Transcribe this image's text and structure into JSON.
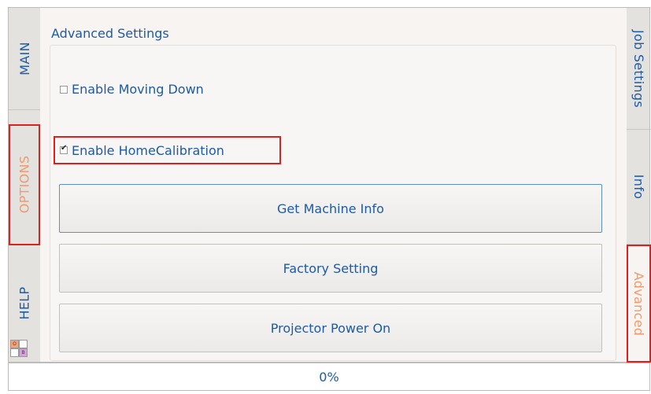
{
  "left_tabs": [
    {
      "label": "MAIN",
      "active": false
    },
    {
      "label": "OPTIONS",
      "active": true
    },
    {
      "label": "HELP",
      "active": false
    }
  ],
  "right_tabs": [
    {
      "label": "Job Settings",
      "active": false
    },
    {
      "label": "Info",
      "active": false
    },
    {
      "label": "Advanced",
      "active": true
    }
  ],
  "panel": {
    "title": "Advanced Settings",
    "checkboxes": [
      {
        "label": "Enable Moving Down",
        "checked": false
      },
      {
        "label": "Enable HomeCalibration",
        "checked": true
      }
    ],
    "buttons": [
      {
        "label": "Get Machine Info"
      },
      {
        "label": "Factory Setting"
      },
      {
        "label": "Projector Power On"
      }
    ]
  },
  "swatches": [
    {
      "label": "O",
      "color": "#f2a37a"
    },
    {
      "label": "",
      "color": "#ffffff"
    },
    {
      "label": "",
      "color": "#ffffff"
    },
    {
      "label": "B",
      "color": "#d6a3d8"
    }
  ],
  "progress": {
    "value": "0%"
  },
  "colors": {
    "accent": "#1e5aa6",
    "active_tab": "#f09a6e",
    "highlight": "#e02020"
  }
}
